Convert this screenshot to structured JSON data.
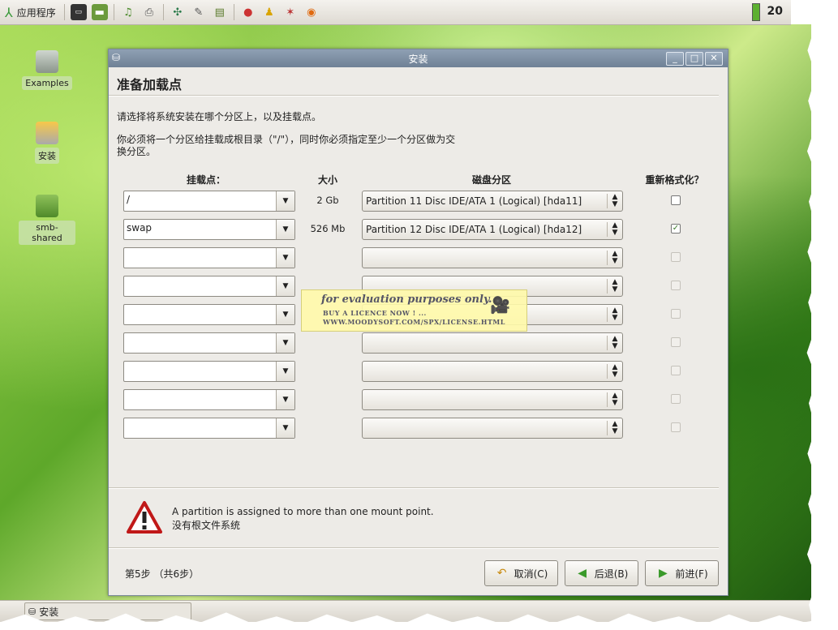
{
  "top_panel": {
    "apps_menu_label": "应用程序",
    "clock": "20",
    "launchers": [
      "terminal-icon",
      "folder-icon",
      "music-icon",
      "printer-icon",
      "network-icon",
      "editor-icon",
      "book-icon",
      "mail-icon",
      "messenger-icon",
      "star-icon",
      "firefox-icon"
    ]
  },
  "desktop": {
    "icons": [
      {
        "label": "Examples"
      },
      {
        "label": "安装"
      },
      {
        "label": "smb-shared"
      }
    ]
  },
  "window": {
    "title": "安装",
    "heading": "准备加载点",
    "intro1": "请选择将系统安装在哪个分区上，以及挂载点。",
    "intro2": "你必须将一个分区给挂载成根目录（\"/\"），同时你必须指定至少一个分区做为交换分区。",
    "columns": {
      "mount": "挂载点：",
      "size": "大小",
      "partition": "磁盘分区",
      "reformat": "重新格式化？"
    },
    "rows": [
      {
        "mount": "/",
        "size": "2 Gb",
        "partition": "Partition 11 Disc IDE/ATA 1 (Logical) [hda11]",
        "reformat": false,
        "enabled": true
      },
      {
        "mount": "swap",
        "size": "526 Mb",
        "partition": "Partition 12 Disc IDE/ATA 1 (Logical) [hda12]",
        "reformat": true,
        "enabled": true
      },
      {
        "mount": "",
        "size": "",
        "partition": "",
        "reformat": false,
        "enabled": false
      },
      {
        "mount": "",
        "size": "",
        "partition": "",
        "reformat": false,
        "enabled": false
      },
      {
        "mount": "",
        "size": "",
        "partition": "",
        "reformat": false,
        "enabled": false
      },
      {
        "mount": "",
        "size": "",
        "partition": "",
        "reformat": false,
        "enabled": false
      },
      {
        "mount": "",
        "size": "",
        "partition": "",
        "reformat": false,
        "enabled": false
      },
      {
        "mount": "",
        "size": "",
        "partition": "",
        "reformat": false,
        "enabled": false
      },
      {
        "mount": "",
        "size": "",
        "partition": "",
        "reformat": false,
        "enabled": false
      }
    ],
    "warning_line1": "A partition is assigned to more than one mount point.",
    "warning_line2": "没有根文件系统",
    "step": "第5步 （共6步）",
    "buttons": {
      "cancel": "取消(C)",
      "back": "后退(B)",
      "forward": "前进(F)"
    }
  },
  "watermark": {
    "line1": "for evaluation purposes only.",
    "line2": "BUY A LICENCE NOW ! ...",
    "line3": "WWW.MOODYSOFT.COM/SPX/LICENSE.HTML"
  },
  "taskbar": {
    "item_label": "安装"
  }
}
